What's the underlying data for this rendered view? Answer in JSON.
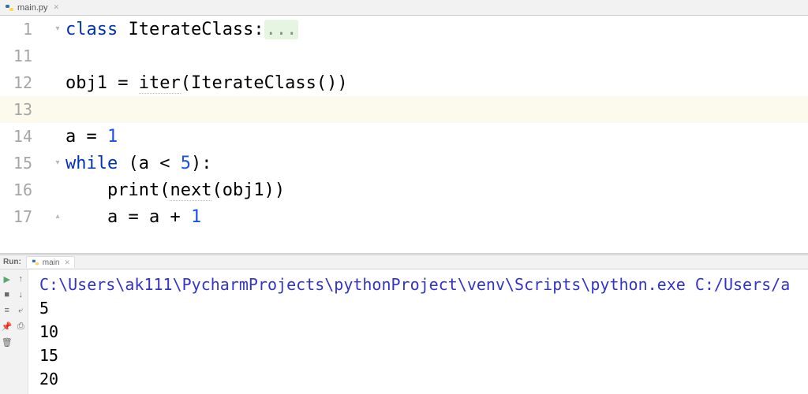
{
  "editor": {
    "tab": {
      "filename": "main.py"
    },
    "lines": [
      {
        "n": 1,
        "fold": "down",
        "segments": [
          {
            "t": "class ",
            "c": "kw"
          },
          {
            "t": "IterateClass:"
          },
          {
            "t": "...",
            "c": "folded"
          }
        ]
      },
      {
        "n": 11,
        "segments": []
      },
      {
        "n": 12,
        "segments": [
          {
            "t": "obj1 = "
          },
          {
            "t": "iter",
            "c": "dotted"
          },
          {
            "t": "(IterateClass())"
          }
        ]
      },
      {
        "n": 13,
        "highlight": true,
        "segments": []
      },
      {
        "n": 14,
        "segments": [
          {
            "t": "a = "
          },
          {
            "t": "1",
            "c": "num"
          }
        ]
      },
      {
        "n": 15,
        "fold": "down",
        "segments": [
          {
            "t": "while ",
            "c": "kw"
          },
          {
            "t": "(a < "
          },
          {
            "t": "5",
            "c": "num"
          },
          {
            "t": "):"
          }
        ]
      },
      {
        "n": 16,
        "segments": [
          {
            "t": "    "
          },
          {
            "t": "print",
            "c": "fn-builtin"
          },
          {
            "t": "("
          },
          {
            "t": "next",
            "c": "dotted"
          },
          {
            "t": "(obj1))"
          }
        ]
      },
      {
        "n": 17,
        "fold": "up",
        "segments": [
          {
            "t": "    a = a + "
          },
          {
            "t": "1",
            "c": "num"
          }
        ]
      }
    ]
  },
  "run": {
    "panel_label": "Run:",
    "tab_name": "main",
    "command": "C:\\Users\\ak111\\PycharmProjects\\pythonProject\\venv\\Scripts\\python.exe C:/Users/a",
    "output": [
      "5",
      "10",
      "15",
      "20"
    ]
  }
}
